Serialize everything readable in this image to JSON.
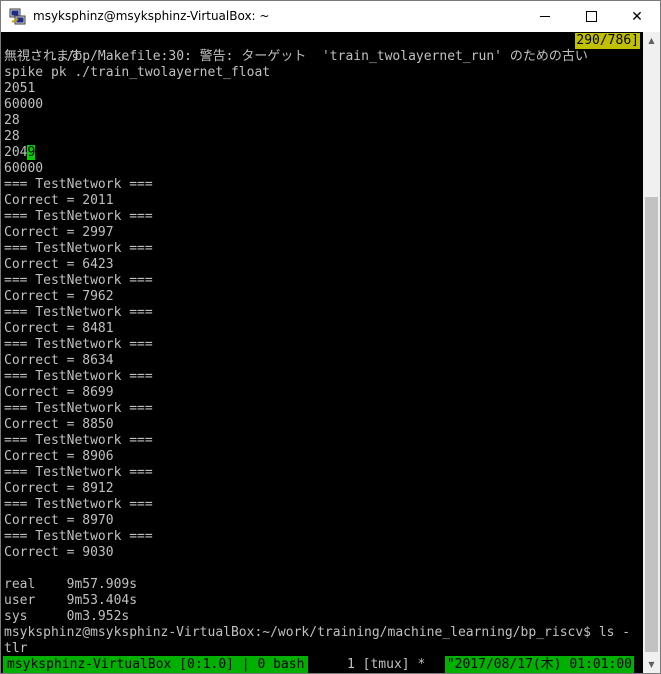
{
  "window": {
    "title": "msyksphinz@msyksphinz-VirtualBox: ~",
    "min_glyph": "",
    "max_glyph": "",
    "close_glyph": "✕"
  },
  "terminal": {
    "header_line": "../bp/Makefile:30: 警告: ターゲット  'train_twolayernet_run' のための古い",
    "header_hl": "290/786]",
    "lines": [
      "無視されます",
      "spike pk ./train_twolayernet_float",
      "2051",
      "60000",
      "28",
      "28",
      "",
      "60000",
      "=== TestNetwork ===",
      "Correct = 2011",
      "=== TestNetwork ===",
      "Correct = 2997",
      "=== TestNetwork ===",
      "Correct = 6423",
      "=== TestNetwork ===",
      "Correct = 7962",
      "=== TestNetwork ===",
      "Correct = 8481",
      "=== TestNetwork ===",
      "Correct = 8634",
      "=== TestNetwork ===",
      "Correct = 8699",
      "=== TestNetwork ===",
      "Correct = 8850",
      "=== TestNetwork ===",
      "Correct = 8906",
      "=== TestNetwork ===",
      "Correct = 8912",
      "=== TestNetwork ===",
      "Correct = 8970",
      "=== TestNetwork ===",
      "Correct = 9030",
      "",
      "real    9m57.909s",
      "user    9m53.404s",
      "sys     0m3.952s",
      "msyksphinz@msyksphinz-VirtualBox:~/work/training/machine_learning/bp_riscv$ ls -",
      "tlr"
    ],
    "cursor_line_prefix": "204",
    "cursor_char": "9"
  },
  "status_bar": {
    "left": "msyksphinz-VirtualBox [0:1.0] | 0 bash",
    "middle": "1 [tmux] *",
    "right": "\"2017/08/17(木) 01:01:00"
  },
  "colors": {
    "terminal_bg": "#000000",
    "terminal_fg": "#c0c0c0",
    "status_green": "#00b000",
    "highlight_yellow": "#c0c000"
  }
}
